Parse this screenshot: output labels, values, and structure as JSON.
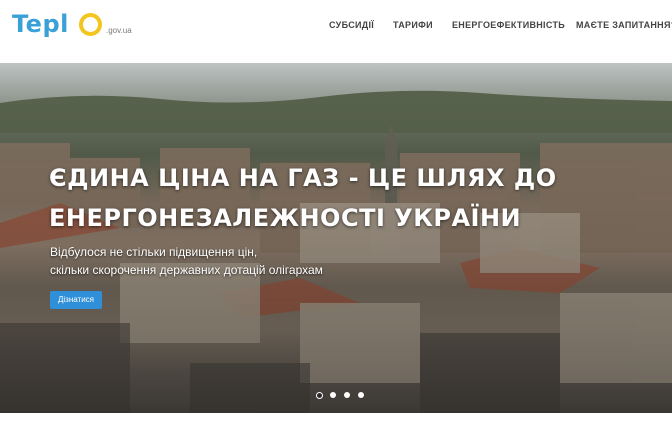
{
  "header": {
    "logo_text": "Tepl",
    "logo_domain": ".gov.ua",
    "nav": [
      {
        "label": "СУБСИДІЇ"
      },
      {
        "label": "ТАРИФИ"
      },
      {
        "label": "ЕНЕРГОЕФЕКТИВНІСТЬ"
      },
      {
        "label": "МАЄТЕ ЗАПИТАННЯ?"
      }
    ]
  },
  "hero": {
    "title_line1": "ЄДИНА ЦІНА НА ГАЗ - ЦЕ ШЛЯХ ДО",
    "title_line2": "ЕНЕРГОНЕЗАЛЕЖНОСТІ УКРАЇНИ",
    "subtitle_line1": "Відбулося не стільки підвищення цін,",
    "subtitle_line2": "скільки скорочення державних дотацій олігархам",
    "button_label": "Дізнатися",
    "carousel": {
      "slides": 4,
      "active": 1
    }
  },
  "colors": {
    "logo_blue": "#3aa0d8",
    "logo_yellow": "#f2c520",
    "button_blue": "#2f8fd8",
    "nav_text": "#444444"
  }
}
